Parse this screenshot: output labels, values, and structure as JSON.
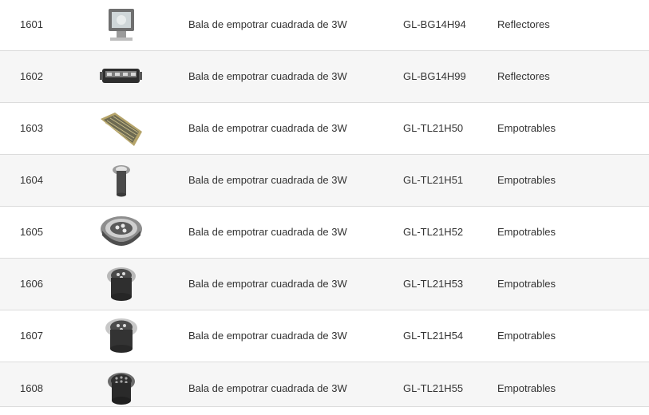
{
  "rows": [
    {
      "id": "1601",
      "name": "Bala de empotrar cuadrada de 3W",
      "code": "GL-BG14H94",
      "category": "Reflectores",
      "icon": "floodlight-icon"
    },
    {
      "id": "1602",
      "name": "Bala de empotrar cuadrada de 3W",
      "code": "GL-BG14H99",
      "category": "Reflectores",
      "icon": "linear-floodlight-icon"
    },
    {
      "id": "1603",
      "name": "Bala de empotrar cuadrada de 3W",
      "code": "GL-TL21H50",
      "category": "Empotrables",
      "icon": "curved-led-panel-icon"
    },
    {
      "id": "1604",
      "name": "Bala de empotrar cuadrada de 3W",
      "code": "GL-TL21H51",
      "category": "Empotrables",
      "icon": "small-inground-light-icon"
    },
    {
      "id": "1605",
      "name": "Bala de empotrar cuadrada de 3W",
      "code": "GL-TL21H52",
      "category": "Empotrables",
      "icon": "round-inground-light-icon"
    },
    {
      "id": "1606",
      "name": "Bala de empotrar cuadrada de 3W",
      "code": "GL-TL21H53",
      "category": "Empotrables",
      "icon": "inground-light-icon"
    },
    {
      "id": "1607",
      "name": "Bala de empotrar cuadrada de 3W",
      "code": "GL-TL21H54",
      "category": "Empotrables",
      "icon": "inground-light-icon"
    },
    {
      "id": "1608",
      "name": "Bala de empotrar cuadrada de 3W",
      "code": "GL-TL21H55",
      "category": "Empotrables",
      "icon": "multi-led-inground-light-icon"
    }
  ]
}
